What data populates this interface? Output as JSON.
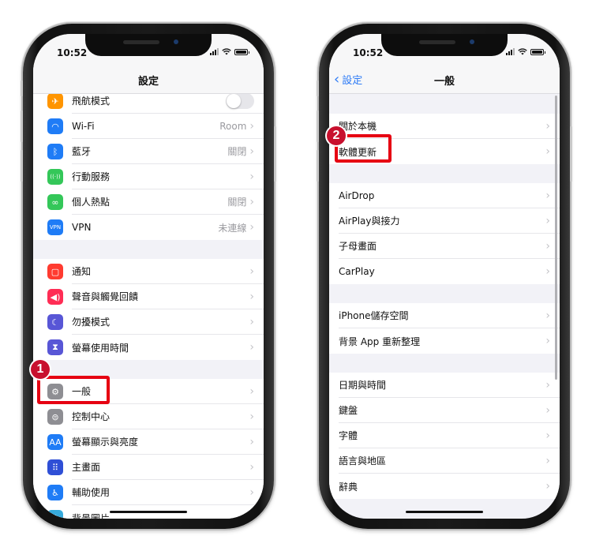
{
  "left_phone": {
    "status": {
      "time": "10:52"
    },
    "nav": {
      "title": "設定"
    },
    "groups": [
      [
        {
          "label": "飛航模式",
          "icon": "airplane-icon",
          "icon_glyph": "✈",
          "color": "#ff9500",
          "toggle": false
        },
        {
          "label": "Wi-Fi",
          "icon": "wifi-icon",
          "icon_glyph": "◠",
          "color": "#1f7cf6",
          "value": "Room"
        },
        {
          "label": "藍牙",
          "icon": "bluetooth-icon",
          "icon_glyph": "ᛒ",
          "color": "#1f7cf6",
          "value": "關閉"
        },
        {
          "label": "行動服務",
          "icon": "cellular-icon",
          "icon_glyph": "((·))",
          "color": "#34c759",
          "value": ""
        },
        {
          "label": "個人熱點",
          "icon": "hotspot-icon",
          "icon_glyph": "∞",
          "color": "#34c759",
          "value": "關閉"
        },
        {
          "label": "VPN",
          "icon": "vpn-icon",
          "icon_glyph": "VPN",
          "color": "#1f7cf6",
          "value": "未連線"
        }
      ],
      [
        {
          "label": "通知",
          "icon": "notifications-icon",
          "icon_glyph": "▢",
          "color": "#ff3b30"
        },
        {
          "label": "聲音與觸覺回饋",
          "icon": "sound-icon",
          "icon_glyph": "◀)",
          "color": "#ff2d55"
        },
        {
          "label": "勿擾模式",
          "icon": "moon-icon",
          "icon_glyph": "☾",
          "color": "#5856d6"
        },
        {
          "label": "螢幕使用時間",
          "icon": "hourglass-icon",
          "icon_glyph": "⧗",
          "color": "#5856d6"
        }
      ],
      [
        {
          "label": "一般",
          "icon": "gear-icon",
          "icon_glyph": "⚙",
          "color": "#8e8e93"
        },
        {
          "label": "控制中心",
          "icon": "control-center-icon",
          "icon_glyph": "⊜",
          "color": "#8e8e93"
        },
        {
          "label": "螢幕顯示與亮度",
          "icon": "display-icon",
          "icon_glyph": "AA",
          "color": "#1f7cf6"
        },
        {
          "label": "主畫面",
          "icon": "home-screen-icon",
          "icon_glyph": "⠿",
          "color": "#2f4fd6"
        },
        {
          "label": "輔助使用",
          "icon": "accessibility-icon",
          "icon_glyph": "♿",
          "color": "#1f7cf6"
        },
        {
          "label": "背景圖片",
          "icon": "wallpaper-icon",
          "icon_glyph": "❀",
          "color": "#36aadc"
        }
      ]
    ],
    "callout": {
      "number": "1",
      "target": "一般"
    }
  },
  "right_phone": {
    "status": {
      "time": "10:52"
    },
    "nav": {
      "title": "一般",
      "back_label": "設定"
    },
    "groups": [
      [
        {
          "label": "關於本機"
        },
        {
          "label": "軟體更新"
        }
      ],
      [
        {
          "label": "AirDrop"
        },
        {
          "label": "AirPlay與接力"
        },
        {
          "label": "子母畫面"
        },
        {
          "label": "CarPlay"
        }
      ],
      [
        {
          "label": "iPhone儲存空間"
        },
        {
          "label": "背景 App 重新整理"
        }
      ],
      [
        {
          "label": "日期與時間"
        },
        {
          "label": "鍵盤"
        },
        {
          "label": "字體"
        },
        {
          "label": "語言與地區"
        },
        {
          "label": "辭典"
        }
      ]
    ],
    "callout": {
      "number": "2",
      "target": "軟體更新"
    }
  },
  "chevron": "›",
  "back_chevron": "‹",
  "colors": {
    "highlight": "#e60012",
    "badge": "#c8102e",
    "link": "#2f7cf6"
  }
}
